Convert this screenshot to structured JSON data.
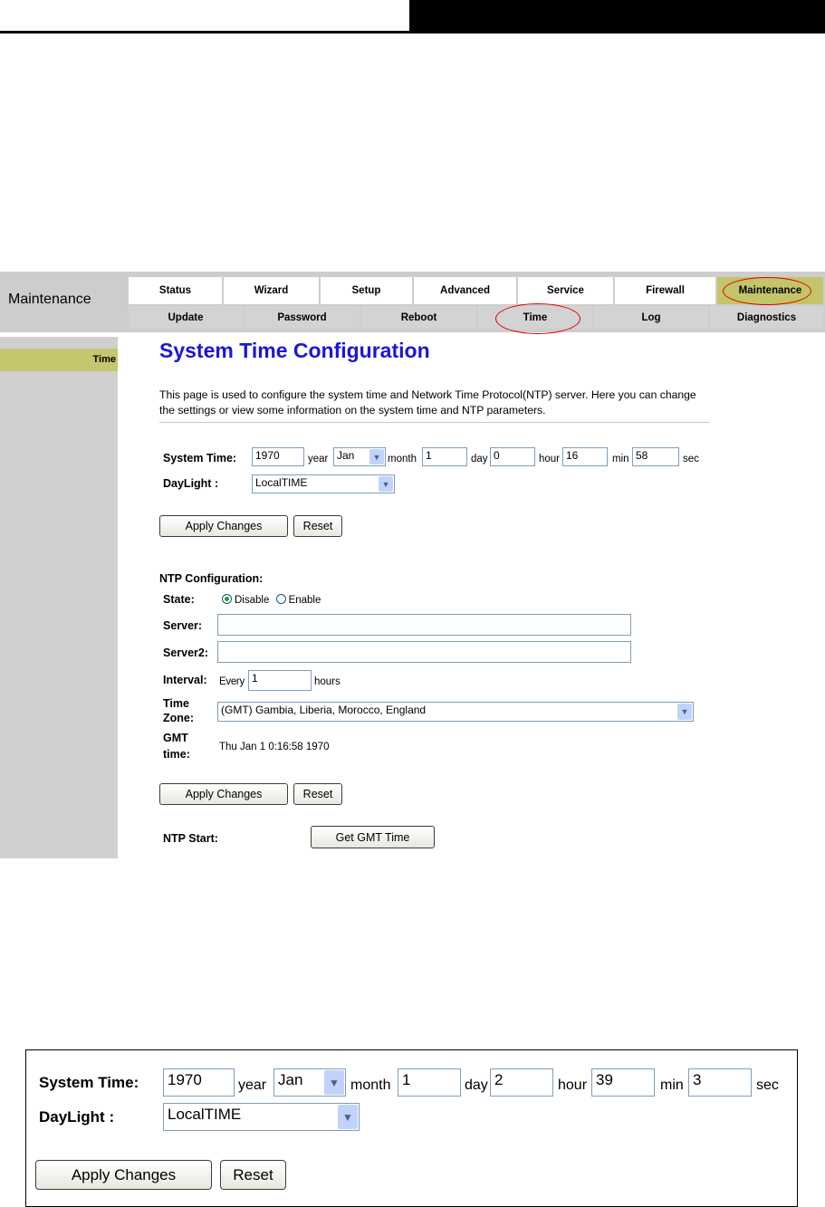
{
  "top_tabs": [
    "Status",
    "Wizard",
    "Setup",
    "Advanced",
    "Service",
    "Firewall",
    "Maintenance"
  ],
  "sub_tabs": [
    "Update",
    "Password",
    "Reboot",
    "Time",
    "Log",
    "Diagnostics"
  ],
  "section_title": "Maintenance",
  "sidebar_item": "Time",
  "page_title": "System Time Configuration",
  "description": "This page is used to configure the system time and Network Time Protocol(NTP) server. Here you can change the settings or view some information on the system time and NTP parameters.",
  "system_time": {
    "label": "System Time:",
    "year": "1970",
    "year_unit": "year",
    "month": "Jan",
    "month_unit": "month",
    "day": "1",
    "day_unit": "day",
    "hour": "0",
    "hour_unit": "hour",
    "min": "16",
    "min_unit": "min",
    "sec": "58",
    "sec_unit": "sec"
  },
  "daylight": {
    "label": "DayLight :",
    "value": "LocalTIME"
  },
  "buttons": {
    "apply": "Apply Changes",
    "reset": "Reset",
    "get_gmt": "Get GMT Time"
  },
  "ntp": {
    "heading": "NTP Configuration:",
    "state_label": "State:",
    "state_options": [
      "Disable",
      "Enable"
    ],
    "state_selected": "Disable",
    "server_label": "Server:",
    "server_value": "",
    "server2_label": "Server2:",
    "server2_value": "",
    "interval_label": "Interval:",
    "interval_prefix": "Every",
    "interval_value": "1",
    "interval_unit": "hours",
    "timezone_label_1": "Time",
    "timezone_label_2": "Zone:",
    "timezone_value": "(GMT) Gambia, Liberia, Morocco, England",
    "gmt_label_1": "GMT",
    "gmt_label_2": "time:",
    "gmt_value": "Thu Jan 1 0:16:58 1970",
    "start_label": "NTP Start:"
  },
  "detail": {
    "system_time_label": "System Time:",
    "year": "1970",
    "year_unit": "year",
    "month": "Jan",
    "month_unit": "month",
    "day": "1",
    "day_unit": "day",
    "hour": "2",
    "hour_unit": "hour",
    "min": "39",
    "min_unit": "min",
    "sec": "3",
    "sec_unit": "sec",
    "daylight_label": "DayLight :",
    "daylight_value": "LocalTIME",
    "apply": "Apply Changes",
    "reset": "Reset"
  },
  "colors": {
    "title_blue": "#1a16d8",
    "active_tab": "#c4c46a",
    "highlight_ellipse": "#e00000",
    "nav_gray": "#cdcdcd"
  }
}
